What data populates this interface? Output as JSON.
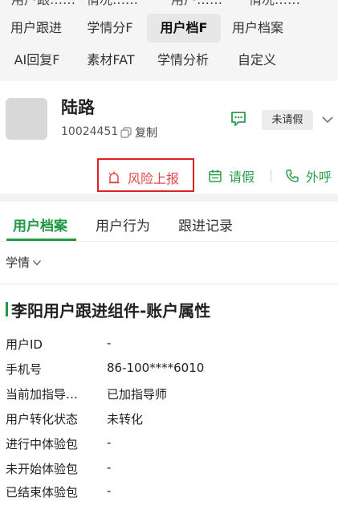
{
  "top_tabs": {
    "row0_cut": [
      "用户跟……",
      "情况……",
      "用户……",
      "情况……"
    ],
    "row1": [
      "用户跟进",
      "学情分F",
      "用户档F",
      "用户档案"
    ],
    "row2": [
      "AI回复F",
      "素材FAT",
      "学情分析",
      "自定义"
    ],
    "active": "用户档F"
  },
  "profile": {
    "name": "陆路",
    "user_id": "10024451",
    "copy_label": "复制",
    "leave_status": "未请假"
  },
  "actions": {
    "risk_report": "风险上报",
    "leave": "请假",
    "outbound_call": "外呼"
  },
  "sub_tabs": [
    "用户档案",
    "用户行为",
    "跟进记录"
  ],
  "filter_label": "学情",
  "section": {
    "title": "李阳用户跟进组件-账户属性",
    "fields": [
      {
        "key": "用户ID",
        "value": "-"
      },
      {
        "key": "手机号",
        "value": "86-100****6010"
      },
      {
        "key": "当前加指导…",
        "value": "已加指导师"
      },
      {
        "key": "用户转化状态",
        "value": "未转化"
      },
      {
        "key": "进行中体验包",
        "value": "-"
      },
      {
        "key": "未开始体验包",
        "value": "-"
      },
      {
        "key": "已结束体验包",
        "value": "-"
      }
    ]
  },
  "colors": {
    "accent_green": "#1f9a43",
    "risk_red": "#e02020",
    "top_bg": "#f5f5f5"
  }
}
